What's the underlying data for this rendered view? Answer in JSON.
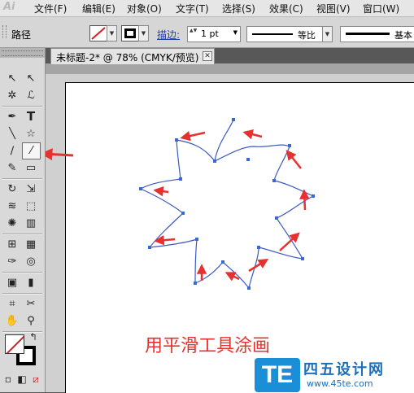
{
  "app": {
    "logo": "Ai"
  },
  "menubar": {
    "items": [
      "文件(F)",
      "编辑(E)",
      "对象(O)",
      "文字(T)",
      "选择(S)",
      "效果(C)",
      "视图(V)",
      "窗口(W)"
    ]
  },
  "control_bar": {
    "object_label": "路径",
    "stroke_label": "描边:",
    "stroke_weight": "1 pt",
    "profile1": "等比",
    "profile2": "基本",
    "dropdown_arrow": "▼",
    "spin_arrows": "▲▼"
  },
  "document": {
    "tab_title": "未标题-2* @ 78% (CMYK/预览)",
    "close_glyph": "✕"
  },
  "toolbox": {
    "tools": [
      {
        "name": "selection-tool",
        "glyph": "↖"
      },
      {
        "name": "direct-selection-tool",
        "glyph": "↖"
      },
      {
        "name": "magic-wand-tool",
        "glyph": "✲"
      },
      {
        "name": "lasso-tool",
        "glyph": "ℒ"
      },
      {
        "name": "pen-tool",
        "glyph": "✒"
      },
      {
        "name": "type-tool",
        "glyph": "T"
      },
      {
        "name": "line-segment-tool",
        "glyph": "╲"
      },
      {
        "name": "star-tool",
        "glyph": "☆"
      },
      {
        "name": "paintbrush-tool",
        "glyph": "∕"
      },
      {
        "name": "smooth-tool",
        "glyph": "⁄"
      },
      {
        "name": "pencil-tool",
        "glyph": "✎"
      },
      {
        "name": "eraser-tool",
        "glyph": "▭"
      },
      {
        "name": "rotate-tool",
        "glyph": "↻"
      },
      {
        "name": "scale-tool",
        "glyph": "⇲"
      },
      {
        "name": "warp-tool",
        "glyph": "≋"
      },
      {
        "name": "free-transform-tool",
        "glyph": "⬚"
      },
      {
        "name": "symbol-sprayer-tool",
        "glyph": "✺"
      },
      {
        "name": "column-graph-tool",
        "glyph": "▥"
      },
      {
        "name": "mesh-tool",
        "glyph": "⊞"
      },
      {
        "name": "gradient-tool",
        "glyph": "▦"
      },
      {
        "name": "eyedropper-tool",
        "glyph": "✑"
      },
      {
        "name": "blend-tool",
        "glyph": "◎"
      },
      {
        "name": "live-paint-bucket-tool",
        "glyph": "▣"
      },
      {
        "name": "bar-chart-tool",
        "glyph": "▮"
      },
      {
        "name": "crop-area-tool",
        "glyph": "⌗"
      },
      {
        "name": "slice-tool",
        "glyph": "✂"
      },
      {
        "name": "hand-tool",
        "glyph": "✋"
      },
      {
        "name": "zoom-tool",
        "glyph": "⚲"
      }
    ],
    "swap_glyph": "↰",
    "mode_buttons": [
      "▫",
      "◧",
      "⧄"
    ]
  },
  "canvas": {
    "caption": "用平滑工具涂画"
  },
  "watermark": {
    "logo": "TE",
    "cn": "四五设计网",
    "url": "www.45te.com"
  },
  "colors": {
    "accent_red": "#e7312e",
    "path_blue": "#3b5bbd",
    "anchor_blue": "#3a66d6",
    "stroke_link_blue": "#1a3fa8"
  }
}
